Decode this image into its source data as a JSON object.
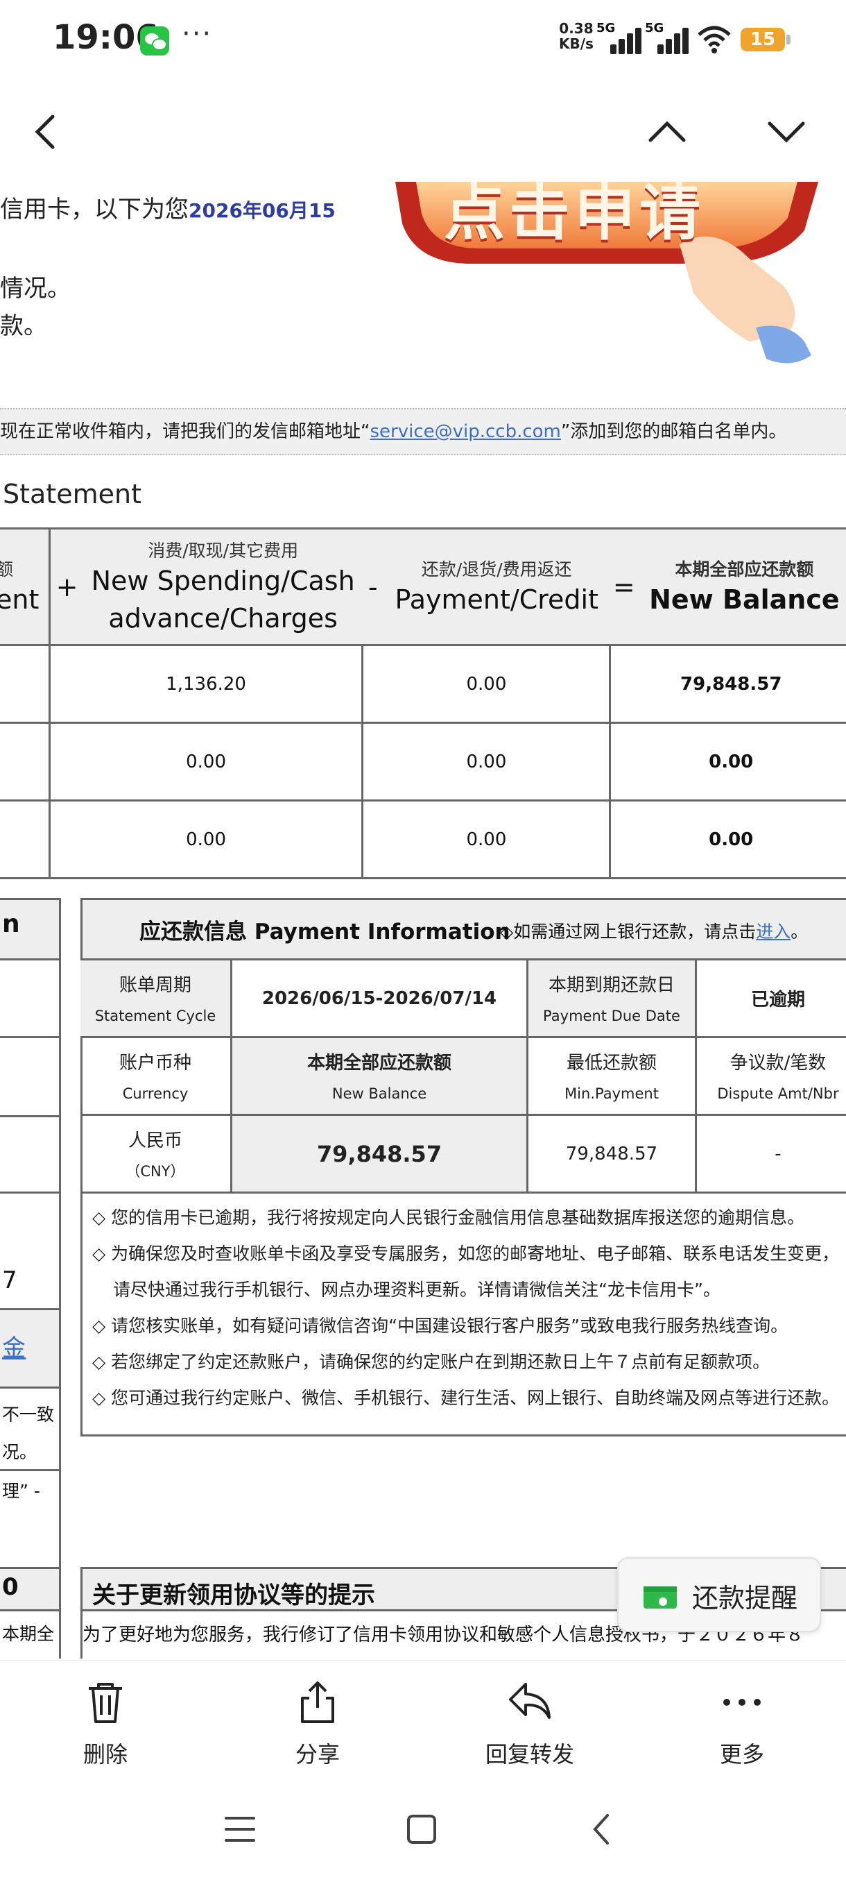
{
  "status_bar": {
    "time": "19:06",
    "more": "···",
    "net_speed_value": "0.38",
    "net_speed_unit": "KB/s",
    "signal_label_1": "5G",
    "signal_label_2": "5G",
    "battery": "15",
    "icons": [
      "wechat-icon",
      "signal-icon",
      "wifi-icon",
      "battery-icon"
    ],
    "battery_color": "#f0a42b"
  },
  "nav": {
    "icons": [
      "back-icon",
      "previous-email-icon",
      "next-email-icon"
    ]
  },
  "email": {
    "intro_line1": "信用卡，以下为您",
    "intro_date": "2026年06月15",
    "intro_line2": "情况。",
    "intro_line3": "款。",
    "banner_text": "点击申请",
    "whitelist_prefix": "现在正常收件箱内，请把我们的发信邮箱地址“",
    "whitelist_email": "service@vip.ccb.com",
    "whitelist_suffix": "”添加到您的邮箱白名单内。",
    "statement_heading": "Statement",
    "summary": {
      "col0_cn": "额",
      "col0_en": "ent",
      "op_plus": "+",
      "col1_cn": "消费/取现/其它费用",
      "col1_en_1": "New Spending/Cash",
      "col1_en_2": "advance/Charges",
      "op_minus": "-",
      "col2_cn": "还款/退货/费用返还",
      "col2_en": "Payment/Credit",
      "op_eq": "=",
      "col3_cn": "本期全部应还款额",
      "col3_en": "New Balance",
      "rows": [
        {
          "spending": "1,136.20",
          "payment": "0.00",
          "balance": "79,848.57"
        },
        {
          "spending": "0.00",
          "payment": "0.00",
          "balance": "0.00"
        },
        {
          "spending": "0.00",
          "payment": "0.00",
          "balance": "0.00"
        }
      ]
    },
    "left_fragments": {
      "f1": "n",
      "f2": "7",
      "f3": "金",
      "f4": "不一致",
      "f5": "况。",
      "f6": "理” -",
      "f7": "0",
      "f8": "本期全"
    },
    "payment_info": {
      "title": "应还款信息 Payment Information",
      "online_prefix": "◇如需通过网上银行还款，请点击",
      "online_link": "进入",
      "online_suffix": "。",
      "cycle_cn": "账单周期",
      "cycle_en": "Statement Cycle",
      "cycle_value": "2026/06/15-2026/07/14",
      "due_cn": "本期到期还款日",
      "due_en": "Payment Due Date",
      "due_value": "已逾期",
      "currency_cn": "账户币种",
      "currency_en": "Currency",
      "newbal_cn": "本期全部应还款额",
      "newbal_en": "New Balance",
      "minpay_cn": "最低还款额",
      "minpay_en": "Min.Payment",
      "dispute_cn": "争议款/笔数",
      "dispute_en": "Dispute Amt/Nbr",
      "currency_value_1": "人民币",
      "currency_value_2": "（CNY）",
      "newbal_value": "79,848.57",
      "minpay_value": "79,848.57",
      "dispute_value": "-",
      "notes": [
        "◇ 您的信用卡已逾期，我行将按规定向人民银行金融信用信息基础数据库报送您的逾期信息。",
        "◇ 为确保您及时查收账单卡函及享受专属服务，如您的邮寄地址、电子邮箱、联系电话发生变更，",
        "请尽快通过我行手机银行、网点办理资料更新。详情请微信关注“龙卡信用卡”。",
        "◇ 请您核实账单，如有疑问请微信咨询“中国建设银行客户服务”或致电我行服务热线查询。",
        "◇ 若您绑定了约定还款账户，请确保您的约定账户在到期还款日上午７点前有足额款项。",
        "◇ 您可通过我行约定账户、微信、手机银行、建行生活、网上银行、自助终端及网点等进行还款。"
      ]
    },
    "update_notice": {
      "title": "关于更新领用协议等的提示",
      "text": "为了更好地为您服务，我行修订了信用卡领用协议和敏感个人信息授权书，于２０２６年８"
    }
  },
  "reminder_button": {
    "label": "还款提醒",
    "icon": "wallet-icon",
    "color": "#2db84a"
  },
  "toolbar": {
    "delete_label": "删除",
    "share_label": "分享",
    "reply_label": "回复转发",
    "more_label": "更多"
  },
  "gesture": {
    "icons": [
      "menu-icon",
      "home-icon",
      "back-gesture-icon"
    ]
  }
}
